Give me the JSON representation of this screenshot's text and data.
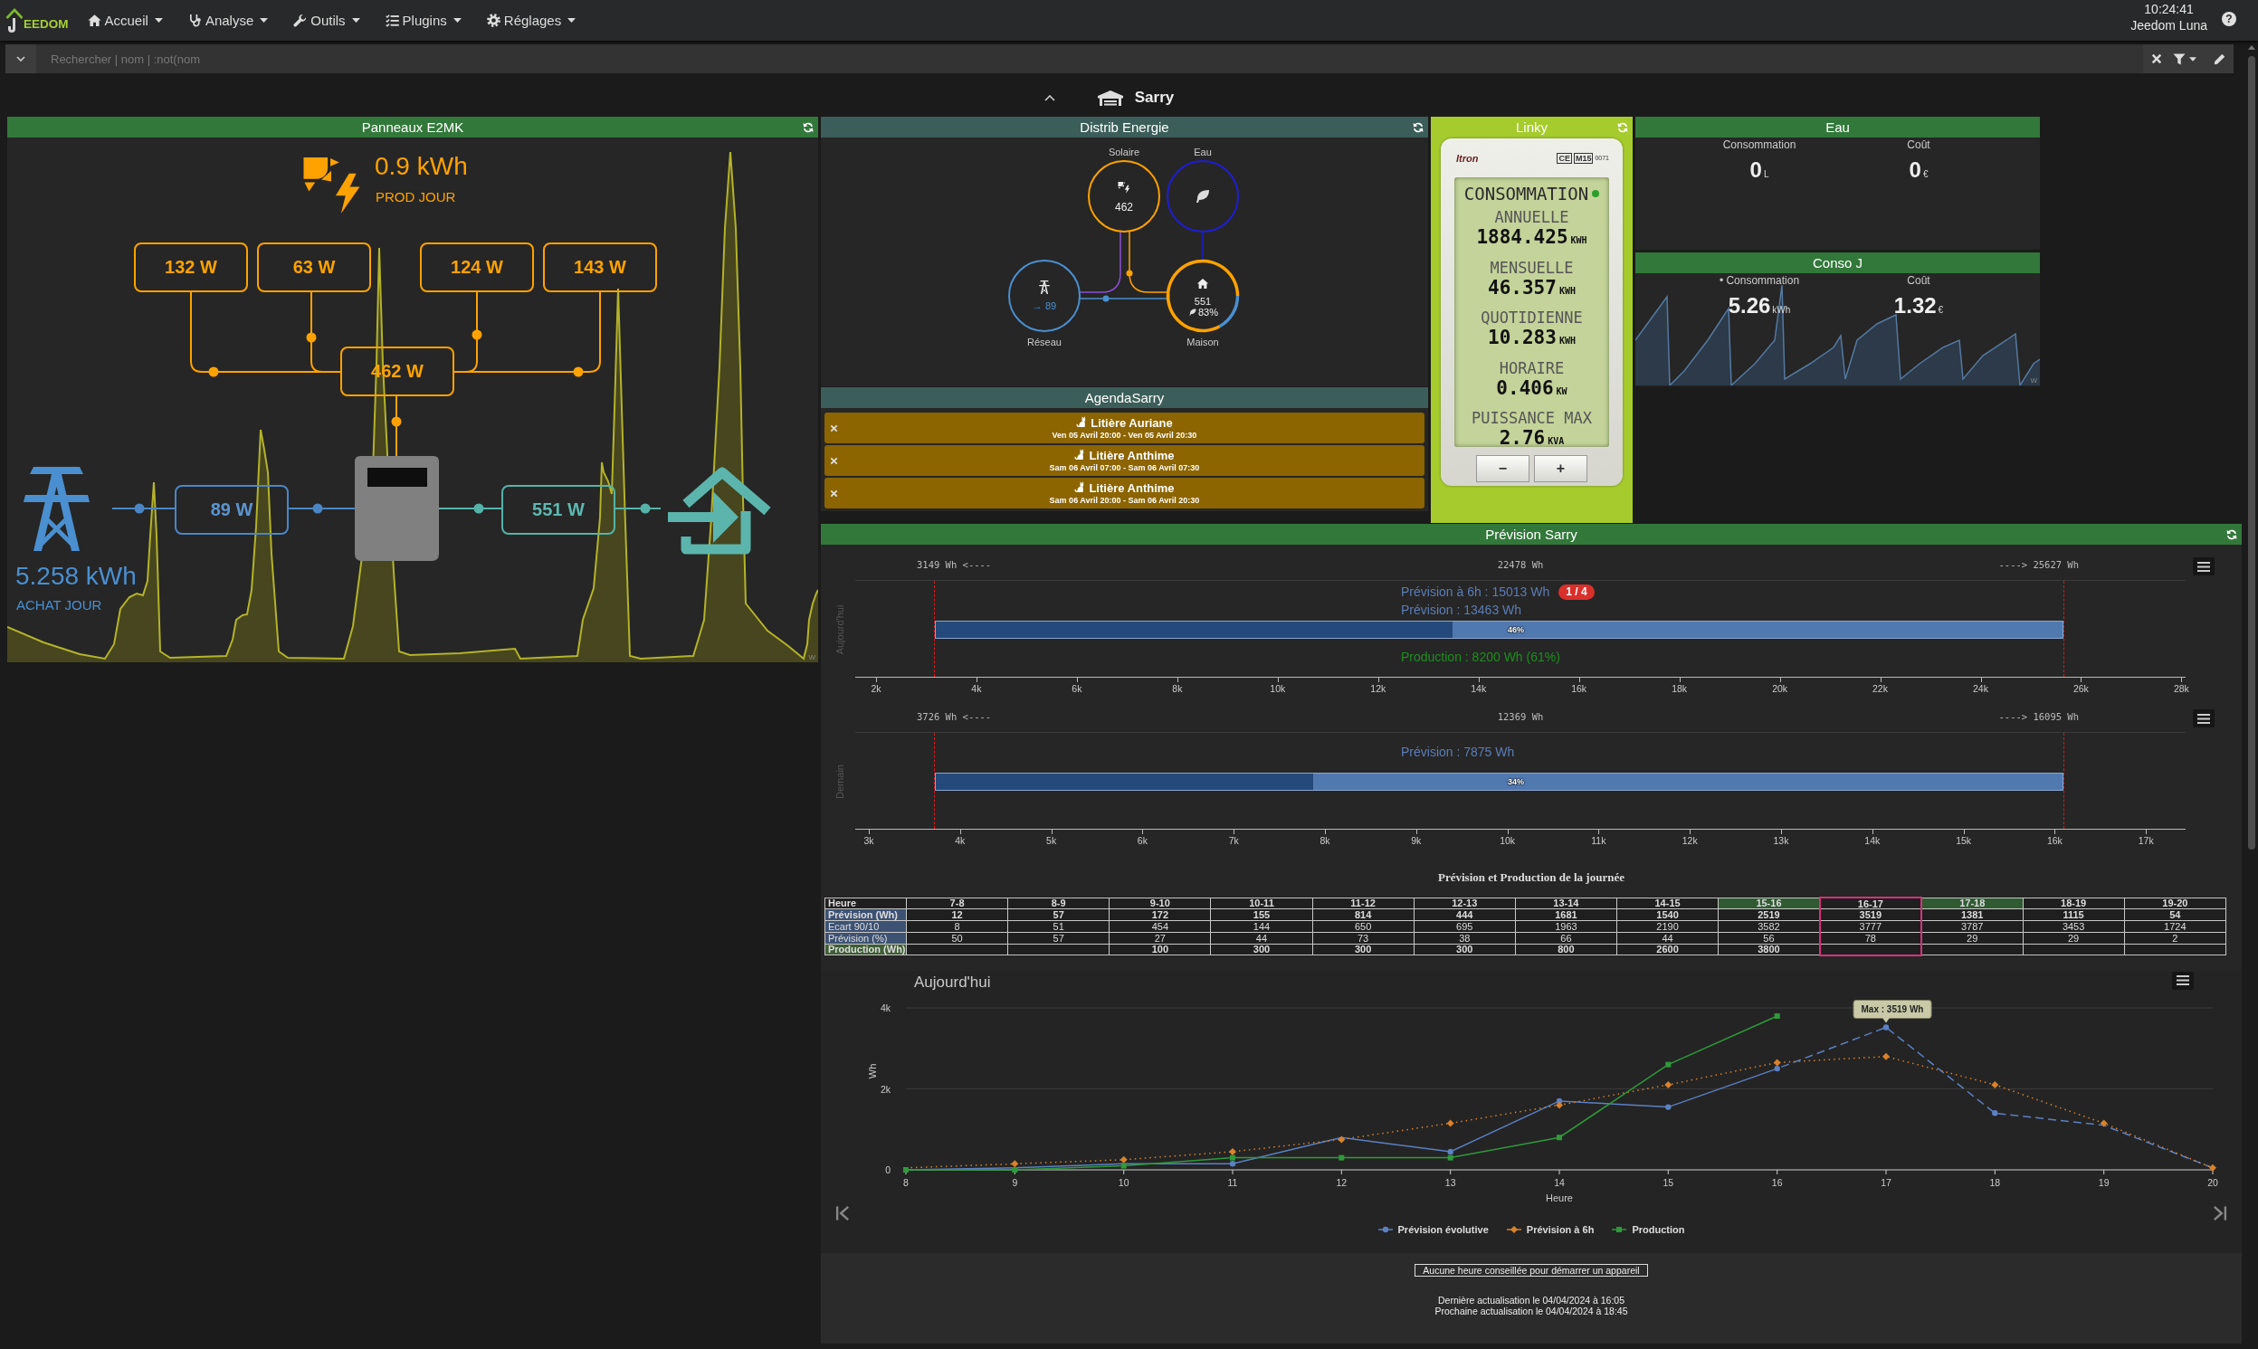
{
  "navbar": {
    "logo": "EEDOM",
    "menus": [
      "Accueil",
      "Analyse",
      "Outils",
      "Plugins",
      "Réglages"
    ],
    "clock": "10:24:41",
    "user": "Jeedom Luna",
    "help": "?"
  },
  "search": {
    "placeholder": "Rechercher | nom | :not(nom"
  },
  "object": {
    "title": "Sarry"
  },
  "solar": {
    "title": "Panneaux E2MK",
    "production": {
      "value": "0.9 kWh",
      "label": "PROD JOUR"
    },
    "strings": [
      "132 W",
      "63 W",
      "124 W",
      "143 W"
    ],
    "inverter": "462 W",
    "grid": "89 W",
    "house": "551 W",
    "purchase": {
      "value": "5.258 kWh",
      "label": "ACHAT JOUR"
    },
    "unit": "W"
  },
  "distribution": {
    "title": "Distrib Energie",
    "nodes": [
      {
        "kind": "solar",
        "label": "Solaire",
        "value": "462"
      },
      {
        "kind": "water",
        "label": "Eau"
      },
      {
        "kind": "grid",
        "label": "Réseau",
        "value": "→ 89"
      },
      {
        "kind": "home",
        "label": "Maison",
        "value": "551",
        "share": "83%",
        "chart_data": {
          "type": "donut",
          "values": [
            83,
            17
          ]
        }
      }
    ]
  },
  "agenda": {
    "title": "AgendaSarry",
    "events": [
      {
        "title": "Litière Auriane",
        "time": "Ven 05 Avril 20:00 - Ven 05 Avril 20:30"
      },
      {
        "title": "Litière Anthime",
        "time": "Sam 06 Avril 07:00 - Sam 06 Avril 07:30"
      },
      {
        "title": "Litière Anthime",
        "time": "Sam 06 Avril 20:00 - Sam 06 Avril 20:30"
      }
    ]
  },
  "linky": {
    "title": "Linky",
    "brand": "Itron",
    "marking": "CE",
    "model": "M15",
    "code": "0071",
    "heading": "CONSOMMATION",
    "readings": [
      {
        "label": "ANNUELLE",
        "value": "1884.425",
        "unit": "KWH"
      },
      {
        "label": "MENSUELLE",
        "value": "46.357",
        "unit": "KWH"
      },
      {
        "label": "QUOTIDIENNE",
        "value": "10.283",
        "unit": "KWH"
      },
      {
        "label": "HORAIRE",
        "value": "0.406",
        "unit": "KW"
      },
      {
        "label": "PUISSANCE MAX",
        "value": "2.76",
        "unit": "KVA"
      }
    ],
    "buttons": [
      "−",
      "+"
    ]
  },
  "water": {
    "title": "Eau",
    "stats": [
      {
        "label": "Consommation",
        "value": "0",
        "unit": "L"
      },
      {
        "label": "Coût",
        "value": "0",
        "unit": "€"
      }
    ]
  },
  "daily": {
    "title": "Conso J",
    "stats": [
      {
        "label": "• Consommation",
        "value": "5.26",
        "unit": "kWh"
      },
      {
        "label": "Coût",
        "value": "1.32",
        "unit": "€"
      }
    ],
    "unit": "W"
  },
  "forecast": {
    "title": "Prévision Sarry",
    "gauges": [
      {
        "label": "Aujourd'hui",
        "low": "3149 Wh <----",
        "mid": "22478 Wh",
        "high": "----> 25627 Wh",
        "lines": [
          {
            "text": "Prévision à 6h : 15013 Wh",
            "badge": "1 / 4"
          },
          {
            "text": "Prévision : 13463 Wh"
          }
        ],
        "level": 0.459,
        "percent": "46%",
        "production": "Production : 8200 Wh (61%)",
        "ticks": [
          "2k",
          "4k",
          "6k",
          "8k",
          "10k",
          "12k",
          "14k",
          "16k",
          "18k",
          "20k",
          "22k",
          "24k",
          "26k",
          "28k"
        ]
      },
      {
        "label": "Demain",
        "low": "3726 Wh <----",
        "mid": "12369 Wh",
        "high": "----> 16095 Wh",
        "lines": [
          {
            "text": "Prévision : 7875 Wh"
          }
        ],
        "level": 0.335,
        "percent": "34%",
        "ticks": [
          "3k",
          "4k",
          "5k",
          "6k",
          "7k",
          "8k",
          "9k",
          "10k",
          "11k",
          "12k",
          "13k",
          "14k",
          "15k",
          "16k",
          "17k"
        ]
      }
    ],
    "table": {
      "title": "Prévision et Production de la journée",
      "corner": "Heure",
      "hours": [
        {
          "label": "7-8",
          "highlighted": false,
          "selected": false
        },
        {
          "label": "8-9",
          "highlighted": false,
          "selected": false
        },
        {
          "label": "9-10",
          "highlighted": false,
          "selected": false
        },
        {
          "label": "10-11",
          "highlighted": false,
          "selected": false
        },
        {
          "label": "11-12",
          "highlighted": false,
          "selected": false
        },
        {
          "label": "12-13",
          "highlighted": false,
          "selected": false
        },
        {
          "label": "13-14",
          "highlighted": false,
          "selected": false
        },
        {
          "label": "14-15",
          "highlighted": false,
          "selected": false
        },
        {
          "label": "15-16",
          "highlighted": true,
          "selected": false
        },
        {
          "label": "16-17",
          "highlighted": false,
          "selected": true
        },
        {
          "label": "17-18",
          "highlighted": true,
          "selected": false
        },
        {
          "label": "18-19",
          "highlighted": false,
          "selected": false
        },
        {
          "label": "19-20",
          "highlighted": false,
          "selected": false
        }
      ],
      "rows": [
        {
          "label": "Prévision (Wh)",
          "color": "#3d5273",
          "emphasized": true,
          "cells": [
            "12",
            "57",
            "172",
            "155",
            "814",
            "444",
            "1681",
            "1540",
            "2519",
            "3519",
            "1381",
            "1115",
            "54"
          ]
        },
        {
          "label": "Ecart 90/10",
          "color": "#3d5273",
          "emphasized": false,
          "cells": [
            "8",
            "51",
            "454",
            "144",
            "650",
            "695",
            "1963",
            "2190",
            "3582",
            "3777",
            "3787",
            "3453",
            "1724"
          ]
        },
        {
          "label": "Prévision (%)",
          "color": "#3d5273",
          "emphasized": false,
          "cells": [
            "50",
            "57",
            "27",
            "44",
            "73",
            "38",
            "66",
            "44",
            "56",
            "78",
            "29",
            "29",
            "2"
          ]
        },
        {
          "label": "Production (Wh)",
          "color": "#3f5e36",
          "emphasized": true,
          "cells": [
            null,
            null,
            "100",
            "300",
            "300",
            "300",
            "800",
            "2600",
            "3800",
            null,
            null,
            null,
            null
          ]
        }
      ]
    },
    "chart": {
      "chart_data": {
        "type": "line",
        "title": "Aujourd'hui",
        "xlabel": "Heure",
        "ylabel": "Wh",
        "x": [
          8,
          9,
          10,
          11,
          12,
          13,
          14,
          15,
          16,
          17,
          18,
          19,
          20
        ],
        "xlim": [
          8,
          20
        ],
        "xticks": [
          8,
          9,
          10,
          11,
          12,
          13,
          14,
          15,
          16,
          17,
          18,
          19,
          20
        ],
        "ylim": [
          0,
          4000
        ],
        "yticks": [
          0,
          {
            "value": 2000,
            "label": "2k"
          },
          {
            "value": 4000,
            "label": "4k"
          }
        ],
        "legend": "bottom",
        "series": [
          {
            "name": "Prévision évolutive",
            "color": "#5b80c4",
            "marker": "circle",
            "line_style": "dashed",
            "values": [
              0,
              50,
              150,
              150,
              800,
              450,
              1700,
              1550,
              2500,
              3519,
              1400,
              1100,
              50
            ]
          },
          {
            "name": "Prévision à 6h",
            "color": "#d9822b",
            "marker": "diamond",
            "line_style": "dotted",
            "values": [
              50,
              150,
              250,
              450,
              750,
              1150,
              1600,
              2100,
              2650,
              2800,
              2100,
              1150,
              50
            ]
          },
          {
            "name": "Production",
            "color": "#2e9a3a",
            "marker": "square",
            "line_style": "solid",
            "values": [
              0,
              0,
              100,
              300,
              300,
              300,
              800,
              2600,
              3800,
              null,
              null,
              null,
              null
            ]
          }
        ],
        "annotations": [
          {
            "x": 17,
            "y": 3519,
            "text": "Max : 3519 Wh"
          }
        ]
      }
    },
    "advice": "Aucune heure conseillée pour démarrer un appareil",
    "updates": [
      "Dernière actualisation le 04/04/2024 à 16:05",
      "Prochaine actualisation le 04/04/2024 à 18:45"
    ]
  }
}
